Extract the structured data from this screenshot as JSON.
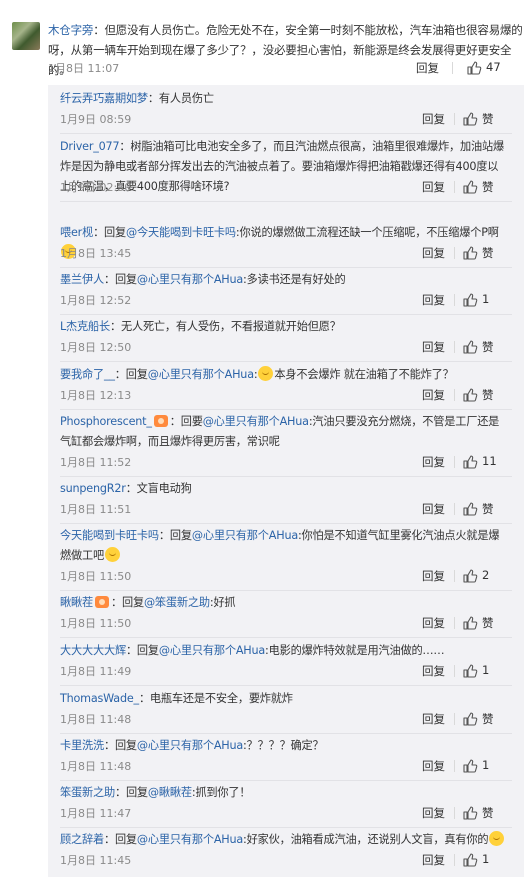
{
  "main_comment": {
    "user": "木仓字旁",
    "text": "：但愿没有人员伤亡。危险无处不在，安全第一时刻不能放松，汽车油箱也很容易爆的呀，从第一辆车开始到现在爆了多少了？，没必要担心害怕，新能源是终会发展得更好更安全的。",
    "date": "1月8日 11:07",
    "reply_label": "回复",
    "like_count": "47"
  },
  "replies": [
    {
      "user": "纤云弄巧嘉期如梦",
      "pre": "",
      "mention": "",
      "text": "：有人员伤亡",
      "emoji": false,
      "post": "",
      "date": "1月9日 08:59",
      "reply_label": "回复",
      "like": "赞"
    },
    {
      "user": "Driver_077",
      "pre": "",
      "mention": "",
      "text": "：树脂油箱可比电池安全多了，而且汽油燃点很高，油箱里很难爆炸，加油站爆炸是因为静电或者部分挥发出去的汽油被点着了。要油箱爆炸得把油箱戳爆还得有400度以上的高温，真要400度那得啥环境?",
      "emoji": false,
      "post": "",
      "date": "1月9日 02:50",
      "reply_label": "回复",
      "like": "赞"
    },
    {
      "user": "喂er枧",
      "pre": "：回复",
      "mention": "@今天能喝到卡旺卡吗",
      "text": ":你说的爆燃做工流程还缺一个压缩呢，不压缩爆个P啊",
      "emoji": true,
      "post": "",
      "date": "1月8日 13:45",
      "reply_label": "回复",
      "like": "赞"
    },
    {
      "user": "墨兰伊人",
      "pre": "：回复",
      "mention": "@心里只有那个AHua",
      "text": ":多读书还是有好处的",
      "emoji": false,
      "post": "",
      "date": "1月8日 12:52",
      "reply_label": "回复",
      "like": "1"
    },
    {
      "user": "L杰克船长",
      "pre": "",
      "mention": "",
      "text": "：无人死亡，有人受伤，不看报道就开始但愿？",
      "emoji": false,
      "post": "",
      "date": "1月8日 12:50",
      "reply_label": "回复",
      "like": "赞"
    },
    {
      "user": "要我命了__",
      "pre": "：回复",
      "mention": "@心里只有那个AHua",
      "text": ":",
      "emoji": true,
      "post": "本身不会爆炸 就在油箱了不能炸了？",
      "date": "1月8日 12:13",
      "reply_label": "回复",
      "like": "赞"
    },
    {
      "user": "Phosphorescent_",
      "pre": "：回要",
      "mention": "@心里只有那个AHua",
      "text": ":汽油只要没充分燃烧，不管是工厂还是气缸都会爆炸啊，而且爆炸得更厉害，常识呢",
      "emoji": false,
      "post": "",
      "date": "1月8日 11:52",
      "reply_label": "回复",
      "like": "11"
    },
    {
      "user": "sunpengR2r",
      "pre": "",
      "mention": "",
      "text": "：文盲电动狗",
      "emoji": false,
      "post": "",
      "date": "1月8日 11:51",
      "reply_label": "回复",
      "like": "赞"
    },
    {
      "user": "今天能喝到卡旺卡吗",
      "pre": "：回复",
      "mention": "@心里只有那个AHua",
      "text": ":你怕是不知道气缸里雾化汽油点火就是爆燃做工吧",
      "emoji": true,
      "post": "",
      "date": "1月8日 11:50",
      "reply_label": "回复",
      "like": "2"
    },
    {
      "user": "瞅瞅茬",
      "pre": "：回复",
      "mention": "@笨蛋新之助",
      "text": ":好抓",
      "emoji": false,
      "post": "",
      "date": "1月8日 11:50",
      "reply_label": "回复",
      "like": "赞"
    },
    {
      "user": "大大大大大辉",
      "pre": "：回复",
      "mention": "@心里只有那个AHua",
      "text": ":电影的爆炸特效就是用汽油做的……",
      "emoji": false,
      "post": "",
      "date": "1月8日 11:49",
      "reply_label": "回复",
      "like": "1"
    },
    {
      "user": "ThomasWade_",
      "pre": "",
      "mention": "",
      "text": "：电瓶车还是不安全，要炸就炸",
      "emoji": false,
      "post": "",
      "date": "1月8日 11:48",
      "reply_label": "回复",
      "like": "赞"
    },
    {
      "user": "卡里洗洗",
      "pre": "：回复",
      "mention": "@心里只有那个AHua",
      "text": ":？？？？确定？",
      "emoji": false,
      "post": "",
      "date": "1月8日 11:48",
      "reply_label": "回复",
      "like": "1"
    },
    {
      "user": "笨蛋新之助",
      "pre": "：回复",
      "mention": "@瞅瞅茬",
      "text": ":抓到你了！",
      "emoji": false,
      "post": "",
      "date": "1月8日 11:47",
      "reply_label": "回复",
      "like": "赞"
    },
    {
      "user": "顾之辞着",
      "pre": "：回复",
      "mention": "@心里只有那个AHua",
      "text": ":好家伙，油箱看成汽油，还说别人文盲，真有你的",
      "emoji": true,
      "post": "",
      "date": "1月8日 11:45",
      "reply_label": "回复",
      "like": "1"
    }
  ],
  "colors": {
    "link": "#2c64a8",
    "text": "#333333",
    "meta": "#8a8a8a",
    "reply_bg": "#f2f2f5"
  },
  "icons": [
    "thumbs-up-icon",
    "emoji-icon",
    "badge-icon"
  ]
}
